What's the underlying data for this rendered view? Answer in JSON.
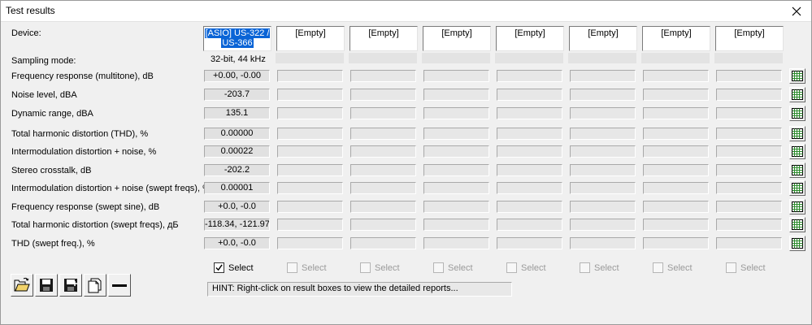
{
  "window": {
    "title": "Test results"
  },
  "labels": {
    "device": "Device:",
    "sampling_mode": "Sampling mode:",
    "rows": [
      "Frequency response (multitone), dB",
      "Noise level, dBA",
      "Dynamic range, dBA",
      "Total harmonic distortion (THD), %",
      "Intermodulation distortion + noise, %",
      "Stereo crosstalk, dB",
      "Intermodulation distortion + noise (swept freqs), %",
      "Frequency response (swept sine), dB",
      "Total harmonic distortion (swept freqs), дБ",
      "THD (swept freq.), %"
    ]
  },
  "devices": [
    {
      "line1": "[ASIO] US-322 /",
      "line2": "US-366"
    },
    {
      "line1": "[Empty]",
      "line2": ""
    },
    {
      "line1": "[Empty]",
      "line2": ""
    },
    {
      "line1": "[Empty]",
      "line2": ""
    },
    {
      "line1": "[Empty]",
      "line2": ""
    },
    {
      "line1": "[Empty]",
      "line2": ""
    },
    {
      "line1": "[Empty]",
      "line2": ""
    },
    {
      "line1": "[Empty]",
      "line2": ""
    }
  ],
  "sampling_value": "32-bit, 44 kHz",
  "results": [
    "+0.00, -0.00",
    "-203.7",
    "135.1",
    "0.00000",
    "0.00022",
    "-202.2",
    "0.00001",
    "+0.0, -0.0",
    "-118.34, -121.97",
    "+0.0, -0.0"
  ],
  "select": {
    "label": "Select",
    "states": [
      true,
      false,
      false,
      false,
      false,
      false,
      false,
      false
    ]
  },
  "hint": "HINT: Right-click on result boxes to view the detailed reports...",
  "toolbar": {
    "icons": [
      "open-folder-icon",
      "save-icon",
      "save-as-icon",
      "copy-report-icon",
      "minus-icon"
    ]
  },
  "colors": {
    "selection": "#0a64d6",
    "grid_icon_green": "#2a8a2a"
  }
}
